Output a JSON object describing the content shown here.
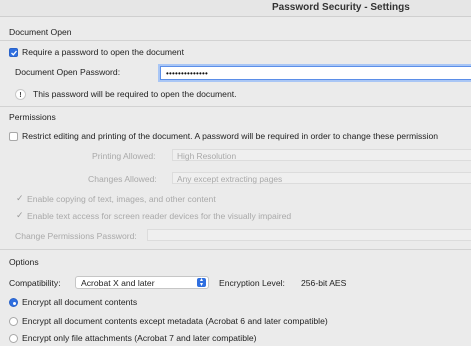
{
  "window": {
    "title": "Password Security - Settings"
  },
  "document_open": {
    "section_label": "Document Open",
    "require_checkbox_label": "Require a password to open the document",
    "require_checked": true,
    "password_label": "Document Open Password:",
    "password_value": "••••••••••••••",
    "info_text": "This password will be required to open the document."
  },
  "permissions": {
    "section_label": "Permissions",
    "restrict_label": "Restrict editing and printing of the document. A password will be required in order to change these permission",
    "restrict_checked": false,
    "printing_label": "Printing Allowed:",
    "printing_value": "High Resolution",
    "changes_label": "Changes Allowed:",
    "changes_value": "Any except extracting pages",
    "copy_label": "Enable copying of text, images, and other content",
    "copy_checked": true,
    "access_label": "Enable text access for screen reader devices for the visually impaired",
    "access_checked": true,
    "change_pwd_label": "Change Permissions Password:"
  },
  "options": {
    "section_label": "Options",
    "compat_label": "Compatibility:",
    "compat_value": "Acrobat X and later",
    "encryption_label": "Encryption  Level:",
    "encryption_value": "256-bit AES",
    "radios": [
      {
        "label": "Encrypt all document contents",
        "selected": true
      },
      {
        "label": "Encrypt all document contents except metadata (Acrobat 6 and later compatible)",
        "selected": false
      },
      {
        "label": "Encrypt only file attachments (Acrobat 7 and later compatible)",
        "selected": false
      }
    ]
  },
  "colors": {
    "accent": "#2f6fe0",
    "background": "#ebebeb",
    "disabled_text": "#a9a9a9"
  }
}
